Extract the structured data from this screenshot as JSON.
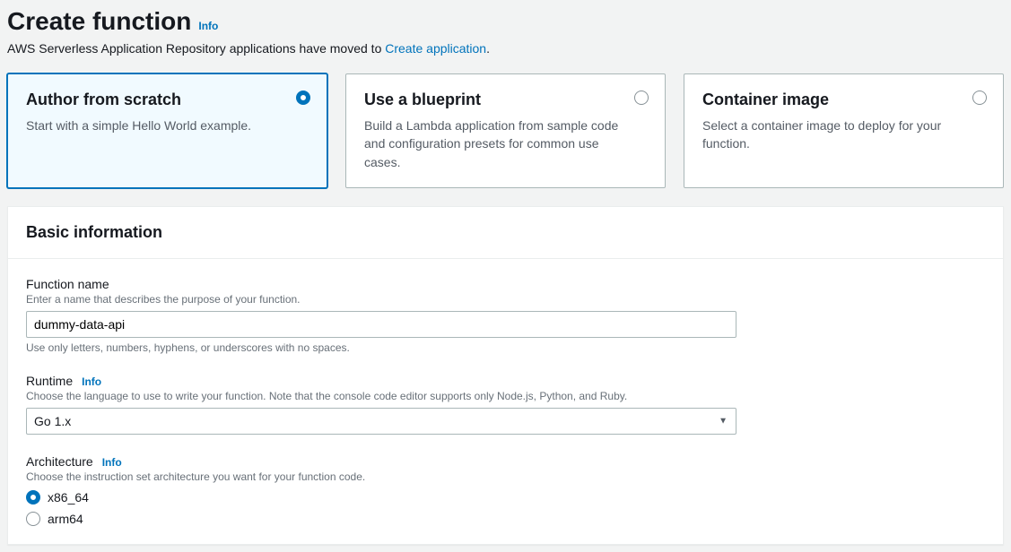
{
  "header": {
    "title": "Create function",
    "info": "Info",
    "subtitle_pre": "AWS Serverless Application Repository applications have moved to ",
    "subtitle_link": "Create application",
    "subtitle_post": "."
  },
  "options": [
    {
      "title": "Author from scratch",
      "desc": "Start with a simple Hello World example.",
      "selected": true
    },
    {
      "title": "Use a blueprint",
      "desc": "Build a Lambda application from sample code and configuration presets for common use cases.",
      "selected": false
    },
    {
      "title": "Container image",
      "desc": "Select a container image to deploy for your function.",
      "selected": false
    }
  ],
  "panel": {
    "title": "Basic information"
  },
  "function_name": {
    "label": "Function name",
    "hint": "Enter a name that describes the purpose of your function.",
    "value": "dummy-data-api",
    "constraint": "Use only letters, numbers, hyphens, or underscores with no spaces."
  },
  "runtime": {
    "label": "Runtime",
    "info": "Info",
    "hint": "Choose the language to use to write your function. Note that the console code editor supports only Node.js, Python, and Ruby.",
    "value": "Go 1.x"
  },
  "architecture": {
    "label": "Architecture",
    "info": "Info",
    "hint": "Choose the instruction set architecture you want for your function code.",
    "options": [
      {
        "label": "x86_64",
        "checked": true
      },
      {
        "label": "arm64",
        "checked": false
      }
    ]
  }
}
